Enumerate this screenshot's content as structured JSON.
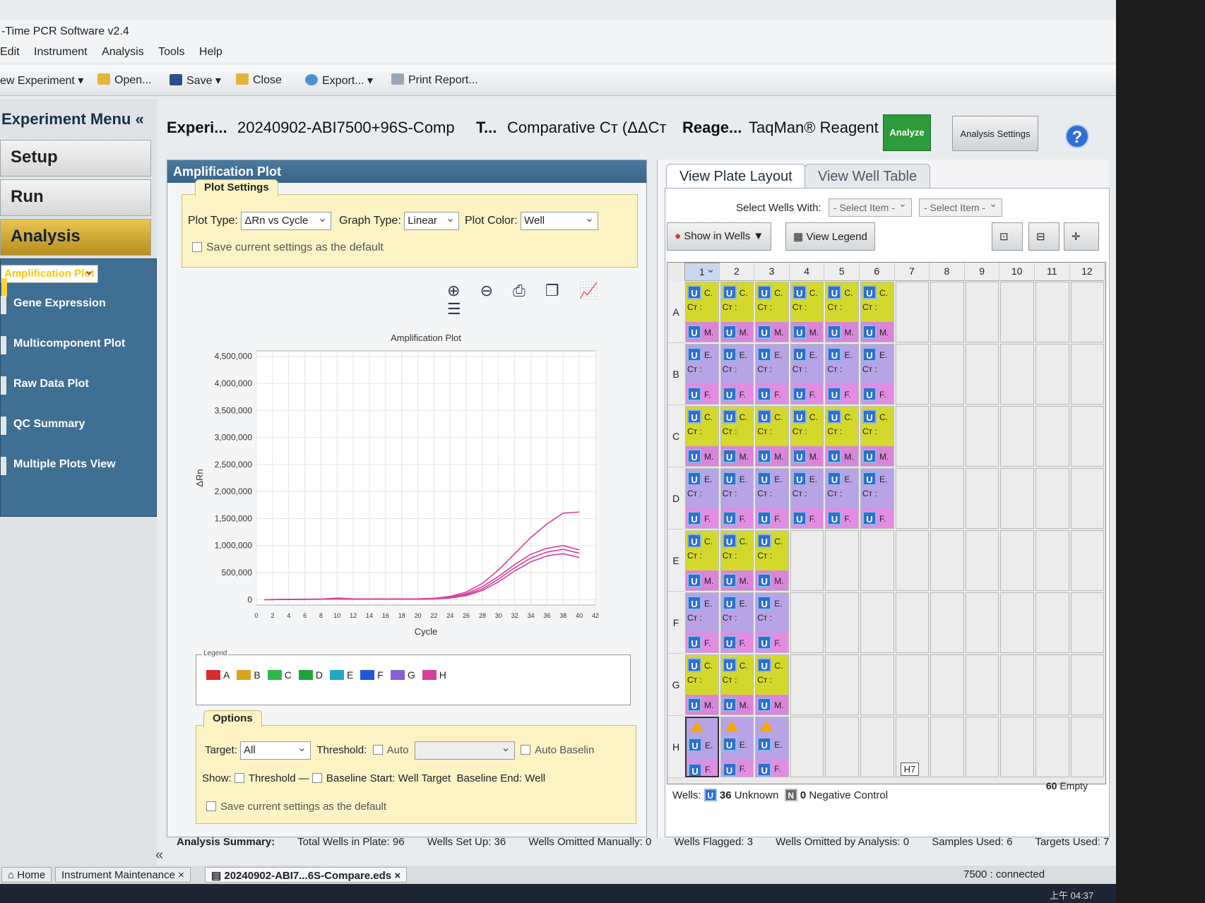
{
  "window": {
    "title": "-Time PCR Software v2.4"
  },
  "menu": [
    "Edit",
    "Instrument",
    "Analysis",
    "Tools",
    "Help"
  ],
  "toolbar": {
    "new_experiment": "ew Experiment",
    "open": "Open...",
    "save": "Save",
    "close": "Close",
    "export": "Export...",
    "print_report": "Print Report..."
  },
  "sidebar": {
    "title": "Experiment Menu «",
    "setup": "Setup",
    "run": "Run",
    "analysis": "Analysis",
    "items": [
      "Amplification Plot",
      "Gene Expression",
      "Multicomponent Plot",
      "Raw Data Plot",
      "QC Summary",
      "Multiple Plots View"
    ],
    "collapse": "«"
  },
  "header": {
    "experiment_label": "Experi...",
    "experiment_name": "20240902-ABI7500+96S-Comp",
    "type_label": "T...",
    "type_value": "Comparative Cт (ΔΔCт",
    "reagent_label": "Reage...",
    "reagent_value": "TaqMan® Reagent",
    "analyze": "Analyze",
    "analysis_settings": "Analysis Settings",
    "help": "?"
  },
  "amp_panel": {
    "title": "Amplification Plot",
    "plot_settings_tab": "Plot Settings",
    "plot_type_label": "Plot Type:",
    "plot_type_value": "ΔRn vs Cycle",
    "graph_type_label": "Graph Type:",
    "graph_type_value": "Linear",
    "plot_color_label": "Plot Color:",
    "plot_color_value": "Well",
    "save_default": "Save current settings as the default",
    "legend_label": "Legend",
    "legend": [
      {
        "label": "A",
        "color": "#d92b2b"
      },
      {
        "label": "B",
        "color": "#d9a420"
      },
      {
        "label": "C",
        "color": "#2fb84a"
      },
      {
        "label": "D",
        "color": "#1fa33a"
      },
      {
        "label": "E",
        "color": "#22a7c4"
      },
      {
        "label": "F",
        "color": "#1f57d6"
      },
      {
        "label": "G",
        "color": "#8a5fd6"
      },
      {
        "label": "H",
        "color": "#d63f9a"
      }
    ],
    "options_tab": "Options",
    "target_label": "Target:",
    "target_value": "All",
    "threshold_label": "Threshold:",
    "auto": "Auto",
    "auto_baseline": "Auto Baselin",
    "show_label": "Show:",
    "show_threshold": "Threshold",
    "baseline_start": "Baseline Start: Well",
    "target_text": "Target",
    "baseline_end": "Baseline End: Well",
    "save_default2": "Save current settings as the default"
  },
  "chart_data": {
    "type": "line",
    "title": "Amplification Plot",
    "xlabel": "Cycle",
    "ylabel": "ΔRn",
    "xlim": [
      0,
      42
    ],
    "ylim": [
      -100000,
      4600000
    ],
    "xticks": [
      0,
      2,
      4,
      6,
      8,
      10,
      12,
      14,
      16,
      18,
      20,
      22,
      24,
      26,
      28,
      30,
      32,
      34,
      36,
      38,
      40,
      42
    ],
    "yticks": [
      0,
      500000,
      1000000,
      1500000,
      2000000,
      2500000,
      3000000,
      3500000,
      4000000,
      4500000
    ],
    "ytick_labels": [
      "0",
      "500,000",
      "1,000,000",
      "1,500,000",
      "2,000,000",
      "2,500,000",
      "3,000,000",
      "3,500,000",
      "4,000,000",
      "4,500,000"
    ],
    "grid": true,
    "x": [
      1,
      4,
      8,
      10,
      12,
      16,
      20,
      22,
      24,
      26,
      28,
      30,
      32,
      34,
      36,
      38,
      40
    ],
    "series": [
      {
        "color": "#d63f9a",
        "values": [
          0,
          5000,
          10000,
          30000,
          15000,
          10000,
          15000,
          25000,
          60000,
          140000,
          300000,
          550000,
          850000,
          1150000,
          1400000,
          1600000,
          1620000
        ]
      },
      {
        "color": "#d63f9a",
        "values": [
          0,
          5000,
          10000,
          20000,
          12000,
          10000,
          12000,
          20000,
          45000,
          110000,
          240000,
          430000,
          650000,
          840000,
          950000,
          1000000,
          920000
        ]
      },
      {
        "color": "#d63f9a",
        "values": [
          0,
          4000,
          8000,
          15000,
          10000,
          8000,
          10000,
          15000,
          35000,
          90000,
          200000,
          380000,
          590000,
          770000,
          880000,
          930000,
          860000
        ]
      },
      {
        "color": "#d63f9a",
        "values": [
          0,
          4000,
          8000,
          12000,
          10000,
          8000,
          10000,
          14000,
          30000,
          75000,
          170000,
          330000,
          530000,
          700000,
          810000,
          850000,
          780000
        ]
      }
    ]
  },
  "right_panel": {
    "tab_layout": "View Plate Layout",
    "tab_table": "View Well Table",
    "select_wells_with": "Select Wells With:",
    "select_item_1": "- Select Item -",
    "select_item_2": "- Select Item -",
    "show_in_wells": "Show in Wells ▼",
    "view_legend": "View Legend",
    "columns": [
      "1",
      "2",
      "3",
      "4",
      "5",
      "6",
      "7",
      "8",
      "9",
      "10",
      "11",
      "12"
    ],
    "rows": [
      "A",
      "B",
      "C",
      "D",
      "E",
      "F",
      "G",
      "H"
    ],
    "tooltip": "H7",
    "wells_label": "Wells:",
    "unknown_count": "36",
    "unknown_label": "Unknown",
    "neg_count": "0",
    "neg_label": "Negative Control",
    "empty_count": "60",
    "empty_label": "Empty"
  },
  "plate_text": {
    "u": "U",
    "n": "N",
    "c": "C.",
    "e": "E.",
    "ct": "Cт :",
    "m": "M.",
    "f": "F.",
    "flag": "!"
  },
  "summary": {
    "label": "Analysis Summary:",
    "total": "Total Wells in Plate: 96",
    "setup": "Wells Set Up: 36",
    "omitted_manual": "Wells Omitted Manually: 0",
    "flagged": "Wells Flagged: 3",
    "omitted_analysis": "Wells Omitted by Analysis: 0",
    "samples": "Samples Used: 6",
    "targets": "Targets Used: 7"
  },
  "status": {
    "home": "Home",
    "maintenance": "Instrument Maintenance",
    "file_tab": "20240902-ABI7...6S-Compare.eds",
    "close_x": "×",
    "connected": "7500 : connected"
  },
  "taskbar": {
    "time": "上午 04:37"
  }
}
